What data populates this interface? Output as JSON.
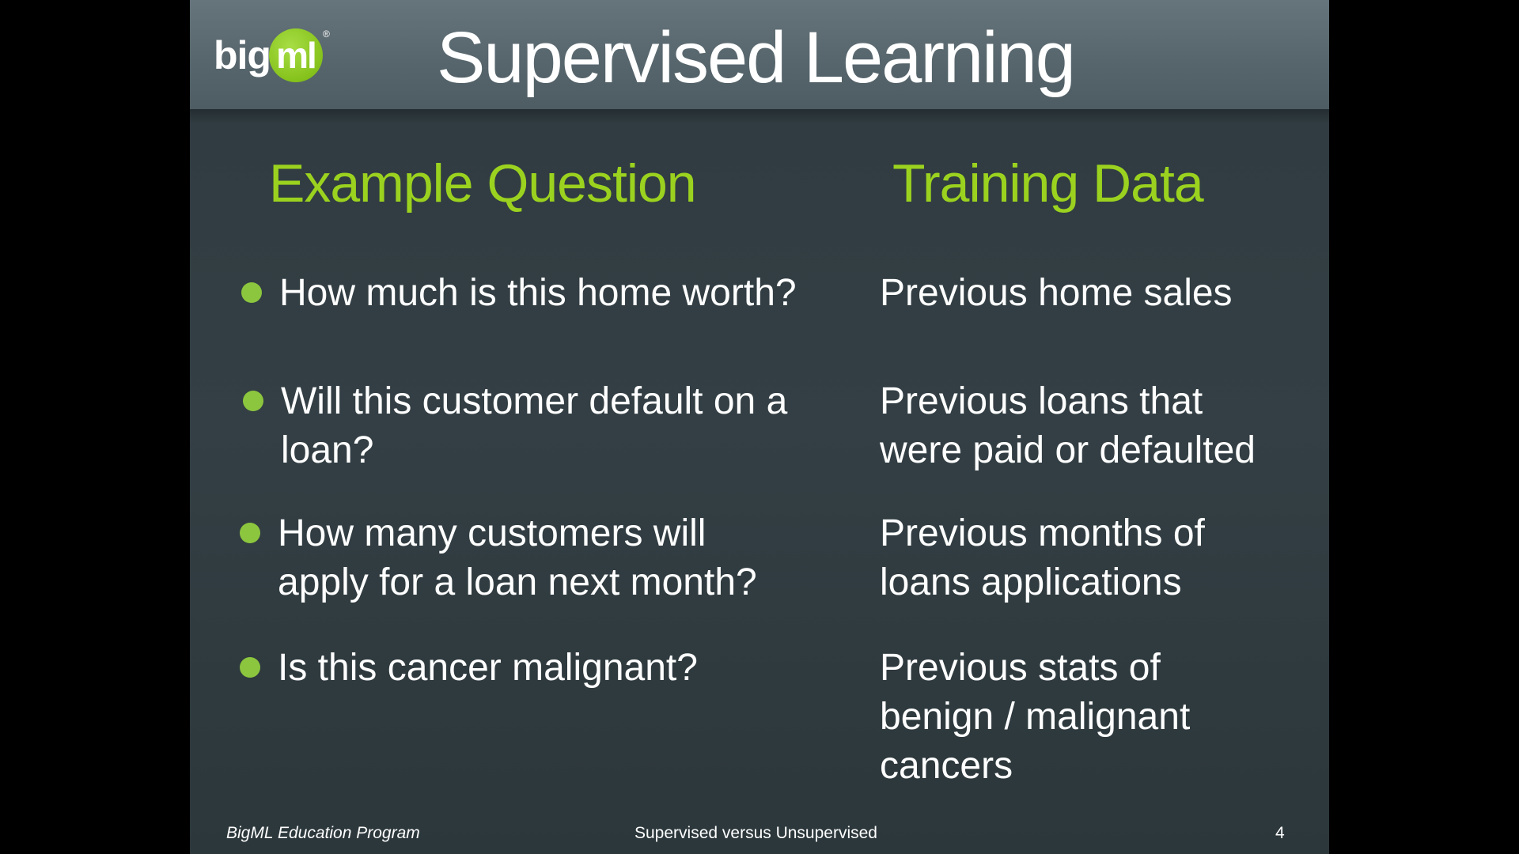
{
  "slide": {
    "logo": {
      "big": "big",
      "ml": "ml",
      "reg": "®"
    },
    "title": "Supervised Learning",
    "columns": {
      "left_heading": "Example Question",
      "right_heading": "Training Data"
    },
    "rows": [
      {
        "question": "How much is this home worth?",
        "training_data": "Previous home sales"
      },
      {
        "question": "Will this customer default on a loan?",
        "training_data": "Previous loans that were paid or defaulted"
      },
      {
        "question": "How many customers will apply for a loan next month?",
        "training_data": "Previous months of loans applications"
      },
      {
        "question": "Is this cancer malignant?",
        "training_data": "Previous stats of benign / malignant cancers"
      }
    ],
    "footer": {
      "left": "BigML Education Program",
      "center": "Supervised versus Unsupervised",
      "page_number": "4"
    }
  },
  "colors": {
    "accent_green": "#9bd21f",
    "bullet_green": "#8cc63e",
    "header_bg": "#5d6b72",
    "body_bg": "#303c41"
  }
}
